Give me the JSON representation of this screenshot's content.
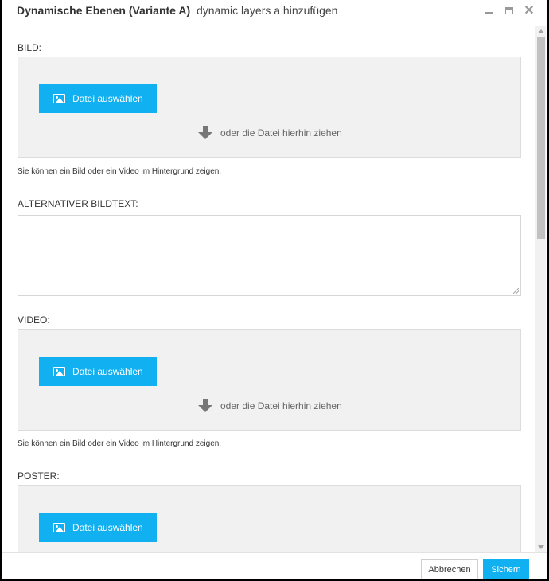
{
  "window": {
    "title": "Dynamische Ebenen (Variante A)",
    "subtitle": "dynamic layers a hinzufügen",
    "minimize_icon": "minimize-icon",
    "maximize_icon": "maximize-icon",
    "close_icon": "close-icon",
    "close_glyph": "✕"
  },
  "fields": {
    "bild": {
      "label": "BILD:",
      "button_label": "Datei auswählen",
      "drop_hint": "oder die Datei hierhin ziehen",
      "help": "Sie können ein Bild oder ein Video im Hintergrund zeigen."
    },
    "alt_text": {
      "label": "ALTERNATIVER BILDTEXT:",
      "value": ""
    },
    "video": {
      "label": "VIDEO:",
      "button_label": "Datei auswählen",
      "drop_hint": "oder die Datei hierhin ziehen",
      "help": "Sie können ein Bild oder ein Video im Hintergrund zeigen."
    },
    "poster": {
      "label": "POSTER:",
      "button_label": "Datei auswählen"
    }
  },
  "footer": {
    "cancel_label": "Abbrechen",
    "save_label": "Sichern"
  },
  "colors": {
    "accent": "#11b0f1",
    "dropzone_bg": "#f1f1f1"
  }
}
